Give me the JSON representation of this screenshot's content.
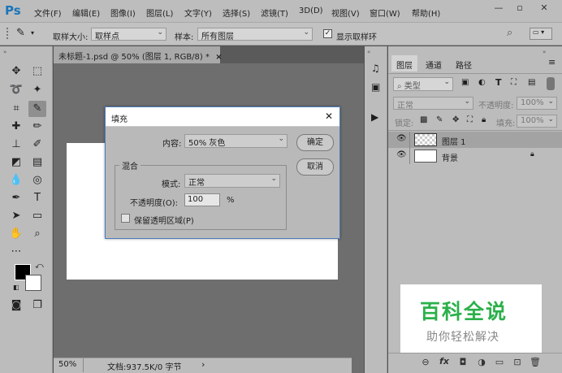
{
  "app": {
    "logo": "Ps"
  },
  "menu": [
    "文件(F)",
    "编辑(E)",
    "图像(I)",
    "图层(L)",
    "文字(Y)",
    "选择(S)",
    "滤镜(T)",
    "3D(D)",
    "视图(V)",
    "窗口(W)",
    "帮助(H)"
  ],
  "window_controls": {
    "minimize": "—",
    "restore": "▫",
    "close": "✕"
  },
  "options": {
    "sample_size_label": "取样大小:",
    "sample_size_value": "取样点",
    "sample_label": "样本:",
    "sample_value": "所有图层",
    "show_ring_label": "显示取样环",
    "show_ring_checked": true
  },
  "document": {
    "tab_title": "未标题-1.psd @ 50% (图层 1, RGB/8) *",
    "tab_close": "×",
    "zoom": "50%",
    "doc_info": "文档:937.5K/0 字节",
    "status_arrow": "›"
  },
  "dialog": {
    "title": "填充",
    "close": "✕",
    "content_label": "内容:",
    "content_value": "50% 灰色",
    "blend_group": "混合",
    "mode_label": "模式:",
    "mode_value": "正常",
    "opacity_label": "不透明度(O):",
    "opacity_value": "100",
    "opacity_unit": "%",
    "preserve_label": "保留透明区域(P)",
    "preserve_checked": false,
    "ok": "确定",
    "cancel": "取消"
  },
  "panel": {
    "tabs": [
      "图层",
      "通道",
      "路径"
    ],
    "kind_filter": "类型",
    "blend_mode": "正常",
    "opacity_label": "不透明度:",
    "opacity_value": "100%",
    "lock_label": "锁定:",
    "fill_label": "填充:",
    "fill_value": "100%",
    "layers": [
      {
        "name": "图层 1",
        "selected": true
      },
      {
        "name": "背景",
        "locked": true
      }
    ]
  },
  "watermark": {
    "title": "百科全说",
    "subtitle": "助你轻松解决"
  },
  "colors": {
    "accent": "#1b75bb",
    "dialog_border": "#4a7dbd",
    "watermark_green": "#2bb04a"
  }
}
